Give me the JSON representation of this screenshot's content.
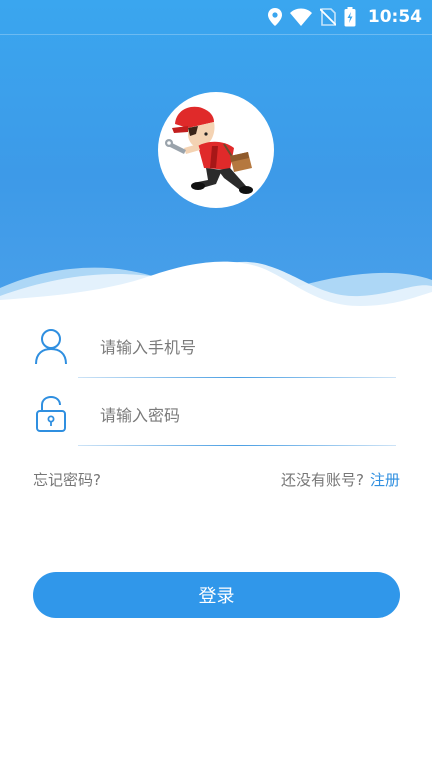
{
  "status_bar": {
    "time": "10:54",
    "icons": [
      "location-icon",
      "wifi-icon",
      "no-sim-icon",
      "battery-charging-icon"
    ]
  },
  "avatar": {
    "icon": "mechanic-mascot-icon"
  },
  "phone_field": {
    "placeholder": "请输入手机号",
    "value": "",
    "icon": "user-icon"
  },
  "password_field": {
    "placeholder": "请输入密码",
    "value": "",
    "icon": "lock-icon"
  },
  "links": {
    "forgot_password": "忘记密码?",
    "no_account": "还没有账号?",
    "register": "注册"
  },
  "login_button": {
    "label": "登录"
  },
  "colors": {
    "header_blue": "#3d9ae8",
    "accent": "#3097ea",
    "link_blue": "#2f8fe0",
    "mascot_red": "#e02a2a"
  }
}
